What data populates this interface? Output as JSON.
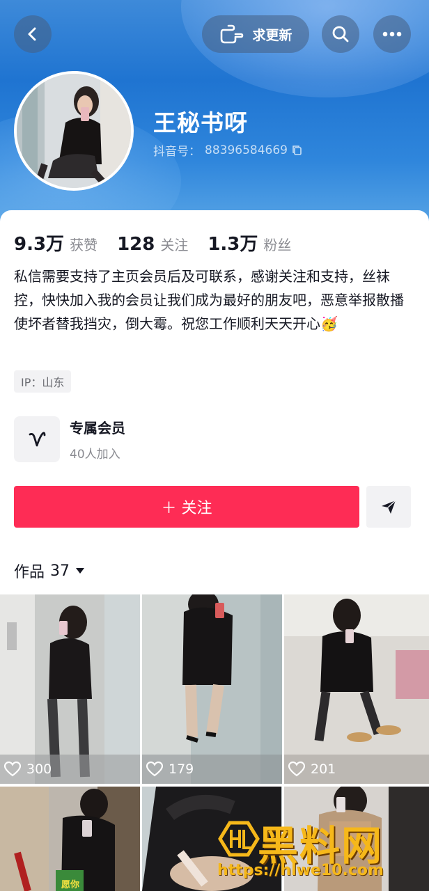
{
  "header": {
    "request_update_label": "求更新",
    "profile_name": "王秘书呀",
    "douyin_id_label": "抖音号：",
    "douyin_id": "88396584669"
  },
  "stats": [
    {
      "num": "9.3万",
      "label": "获赞"
    },
    {
      "num": "128",
      "label": "关注"
    },
    {
      "num": "1.3万",
      "label": "粉丝"
    }
  ],
  "bio": "私信需要支持了主页会员后及可联系，感谢关注和支持，丝袜控，快快加入我的会员让我们成为最好的朋友吧，恶意举报散播使坏者替我挡灾，倒大霉。祝您工作顺利天天开心🥳",
  "ip_label": "IP：山东",
  "membership": {
    "title": "专属会员",
    "subtitle": "40人加入"
  },
  "follow_label": "＋ 关注",
  "works": {
    "label": "作品",
    "count": "37"
  },
  "videos": [
    {
      "likes": "300"
    },
    {
      "likes": "179"
    },
    {
      "likes": "201"
    },
    {
      "likes": ""
    },
    {
      "likes": ""
    },
    {
      "likes": ""
    }
  ],
  "thumb_overlay_text": "愿你",
  "watermark": {
    "text": "黑料网",
    "url": "https://hlwe10.com"
  },
  "colors": {
    "accent": "#fe2c55",
    "header_blue": "#1f74d1",
    "watermark": "#f6b81a"
  }
}
